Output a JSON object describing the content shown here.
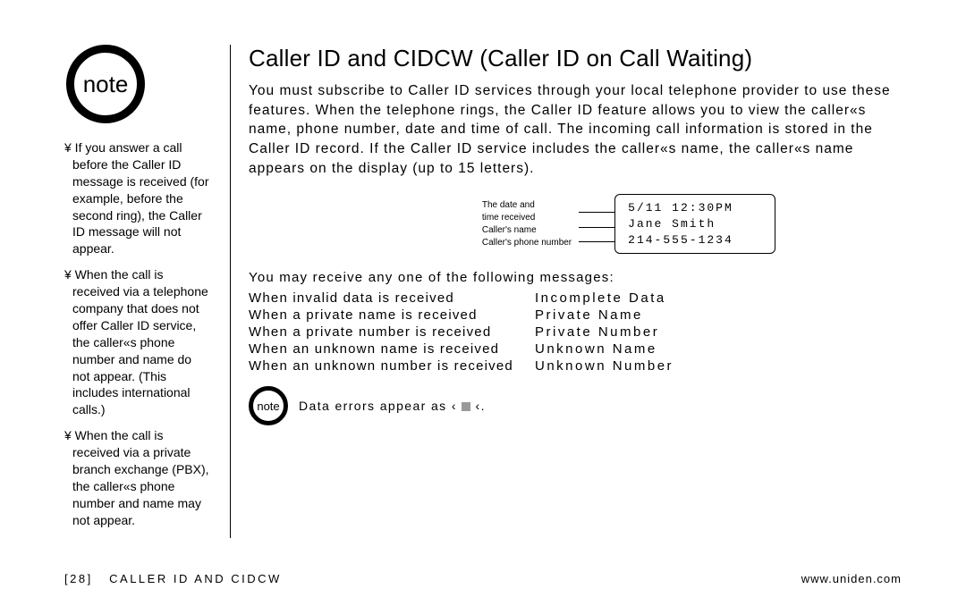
{
  "sidebar": {
    "badge": "note",
    "bullets": [
      "¥ If you answer a call before the Caller ID message is received (for example, before the second ring), the Caller ID message will not appear.",
      "¥ When the call is received via a telephone company that does not offer Caller ID service, the caller«s phone number and name do not appear. (This includes international calls.)",
      "¥ When the call is received via a private branch exchange (PBX), the caller«s phone number and name may not appear."
    ]
  },
  "main": {
    "title": "Caller ID and CIDCW (Caller ID on Call Waiting)",
    "intro": "You must subscribe to Caller ID services through your local telephone provider to use these features. When the telephone rings, the Caller ID feature allows you to view the caller«s name, phone number, date and time of call. The incoming call information is stored in the Caller ID record. If the Caller ID service includes the caller«s name, the caller«s name appears on the display (up to 15 letters).",
    "diagram": {
      "labels": {
        "l1a": "The date and",
        "l1b": "time received",
        "l2": "Caller's name",
        "l3": "Caller's phone number"
      },
      "lcd": {
        "line1": "5/11 12:30PM",
        "line2": "Jane Smith",
        "line3": "214-555-1234"
      }
    },
    "messages_intro": "You may receive any one of the following messages:",
    "messages": [
      {
        "cond": "When invalid data is received",
        "val": "Incomplete Data"
      },
      {
        "cond": "When a private name is received",
        "val": "Private Name"
      },
      {
        "cond": "When a private number is received",
        "val": "Private Number"
      },
      {
        "cond": "When an unknown name is received",
        "val": "Unknown Name"
      },
      {
        "cond": "When an unknown number is received",
        "val": "Unknown Number"
      }
    ],
    "small_note_badge": "note",
    "small_note_pre": "Data errors appear as ‹ ",
    "small_note_post": " ‹."
  },
  "footer": {
    "page": "[28]",
    "section": "CALLER ID AND CIDCW",
    "url": "www.uniden.com"
  }
}
